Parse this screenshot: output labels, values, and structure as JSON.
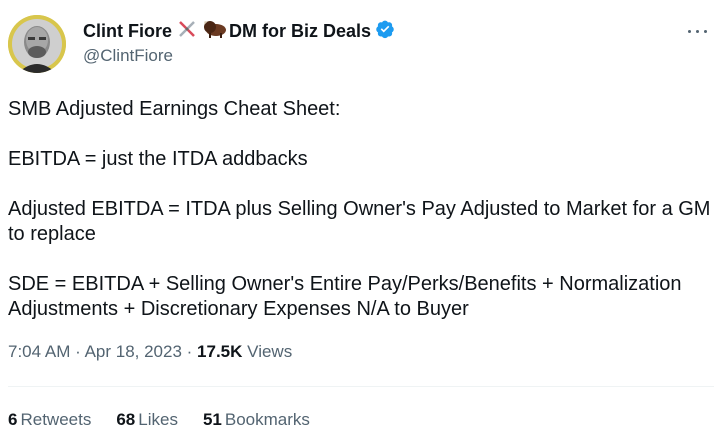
{
  "tweet": {
    "author": {
      "display_name": "Clint Fiore",
      "name_suffix": "DM for Biz Deals",
      "handle": "@ClintFiore",
      "verified": true,
      "emoji_icons": [
        "crossed-swords-icon",
        "bison-icon"
      ]
    },
    "body": [
      "SMB Adjusted Earnings Cheat Sheet:",
      "EBITDA = just the ITDA addbacks",
      "Adjusted EBITDA = ITDA plus Selling Owner's Pay Adjusted to Market for a GM to replace",
      "SDE = EBITDA + Selling Owner's Entire Pay/Perks/Benefits + Normalization Adjustments + Discretionary Expenses N/A to Buyer"
    ],
    "meta": {
      "time": "7:04 AM",
      "date": "Apr 18, 2023",
      "views_count": "17.5K",
      "views_label": "Views",
      "separator": "·"
    },
    "stats": {
      "retweets": {
        "count": "6",
        "label": "Retweets"
      },
      "likes": {
        "count": "68",
        "label": "Likes"
      },
      "bookmarks": {
        "count": "51",
        "label": "Bookmarks"
      }
    }
  },
  "colors": {
    "verified_blue": "#1d9bf0",
    "secondary_text": "#536471",
    "primary_text": "#0f1419",
    "avatar_ring": "#d4c44a"
  }
}
